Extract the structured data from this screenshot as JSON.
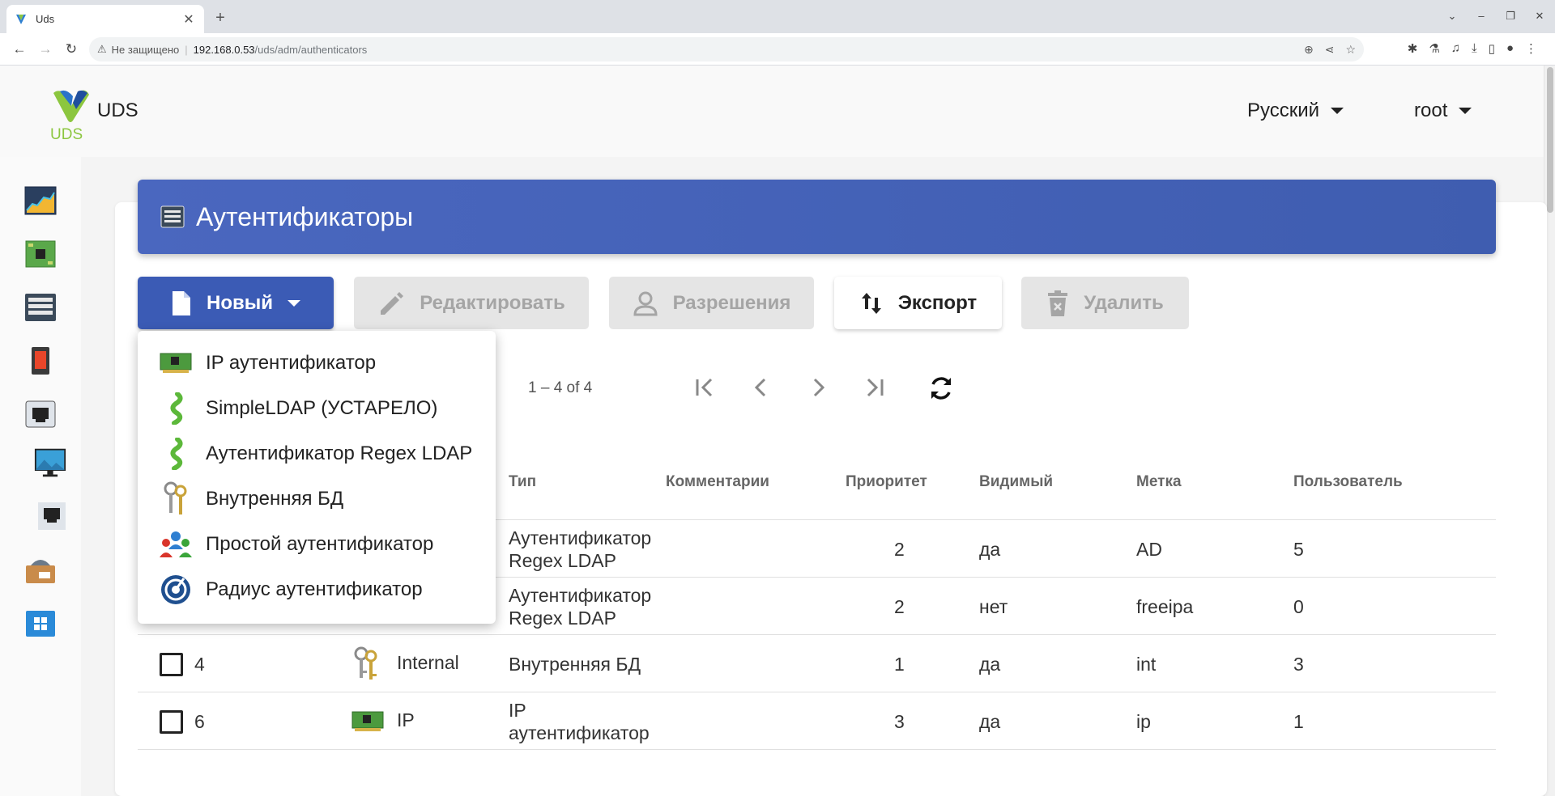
{
  "browser": {
    "tab_title": "Uds",
    "security_label": "Не защищено",
    "url_host": "192.168.0.53",
    "url_path": "/uds/adm/authenticators"
  },
  "header": {
    "brand": "UDS",
    "logo_text": "UDS",
    "language": "Русский",
    "user": "root"
  },
  "page": {
    "title": "Аутентификаторы"
  },
  "toolbar": {
    "new_label": "Новый",
    "edit_label": "Редактировать",
    "permissions_label": "Разрешения",
    "export_label": "Экспорт",
    "delete_label": "Удалить"
  },
  "dropdown": {
    "items": [
      {
        "label": "IP аутентификатор",
        "icon": "network-card-icon"
      },
      {
        "label": "SimpleLDAP (УСТАРЕЛО)",
        "icon": "ldap-worm-icon"
      },
      {
        "label": "Аутентификатор Regex LDAP",
        "icon": "ldap-worm-icon"
      },
      {
        "label": "Внутренняя БД",
        "icon": "keys-icon"
      },
      {
        "label": "Простой аутентификатор",
        "icon": "users-group-icon"
      },
      {
        "label": "Радиус аутентификатор",
        "icon": "radius-icon"
      }
    ]
  },
  "paginator": {
    "range": "1 – 4 of 4"
  },
  "table": {
    "headers": {
      "type": "Тип",
      "comments": "Комментарии",
      "priority": "Приоритет",
      "visible": "Видимый",
      "tag": "Метка",
      "users": "Пользователь"
    },
    "rows": [
      {
        "id": "",
        "name": "",
        "type_line1": "Аутентификатор",
        "type_line2": "Regex LDAP",
        "priority": "2",
        "visible": "да",
        "tag": "AD",
        "users": "5"
      },
      {
        "id": "",
        "name": "",
        "type_line1": "Аутентификатор",
        "type_line2": "Regex LDAP",
        "priority": "2",
        "visible": "нет",
        "tag": "freeipa",
        "users": "0"
      },
      {
        "id": "4",
        "name": "Internal",
        "type_line1": "Внутренняя БД",
        "type_line2": "",
        "priority": "1",
        "visible": "да",
        "tag": "int",
        "users": "3"
      },
      {
        "id": "6",
        "name": "IP",
        "type_line1": "IP",
        "type_line2": "аутентификатор",
        "priority": "3",
        "visible": "да",
        "tag": "ip",
        "users": "1"
      }
    ]
  },
  "colors": {
    "primary": "#3b5bb5",
    "banner": "#4a67bf",
    "disabled_bg": "#e5e5e5",
    "disabled_text": "#a5a5a5"
  }
}
